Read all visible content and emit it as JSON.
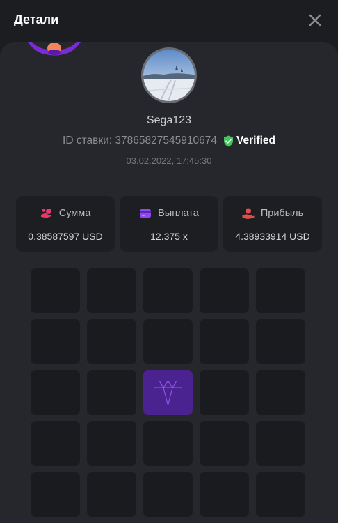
{
  "header": {
    "title": "Детали",
    "close_icon": "close-icon"
  },
  "profile": {
    "username": "Sega123",
    "bet_id": "ID ставки: 37865827545910674",
    "verified_label": "Verified",
    "datetime": "03.02.2022, 17:45:30"
  },
  "stats": [
    {
      "icon": "coins-icon",
      "label": "Сумма",
      "value": "0.38587597 USD"
    },
    {
      "icon": "wallet-icon",
      "label": "Выплата",
      "value": "12.375 x"
    },
    {
      "icon": "hand-coin-icon",
      "label": "Прибыль",
      "value": "4.38933914 USD"
    }
  ],
  "grid": {
    "rows": 5,
    "cols": 5,
    "revealed": [
      {
        "row": 3,
        "col": 3,
        "type": "diamond-icon"
      }
    ]
  },
  "colors": {
    "background": "#1c1d21",
    "panel": "#26272c",
    "card": "#1d1e22",
    "tile": "#1a1b1f",
    "tile_revealed": "#4a2391",
    "verified": "#3fc75a",
    "accent_pink": "#e8376b",
    "accent_purple": "#8e4af0",
    "accent_red": "#e44b4b"
  }
}
